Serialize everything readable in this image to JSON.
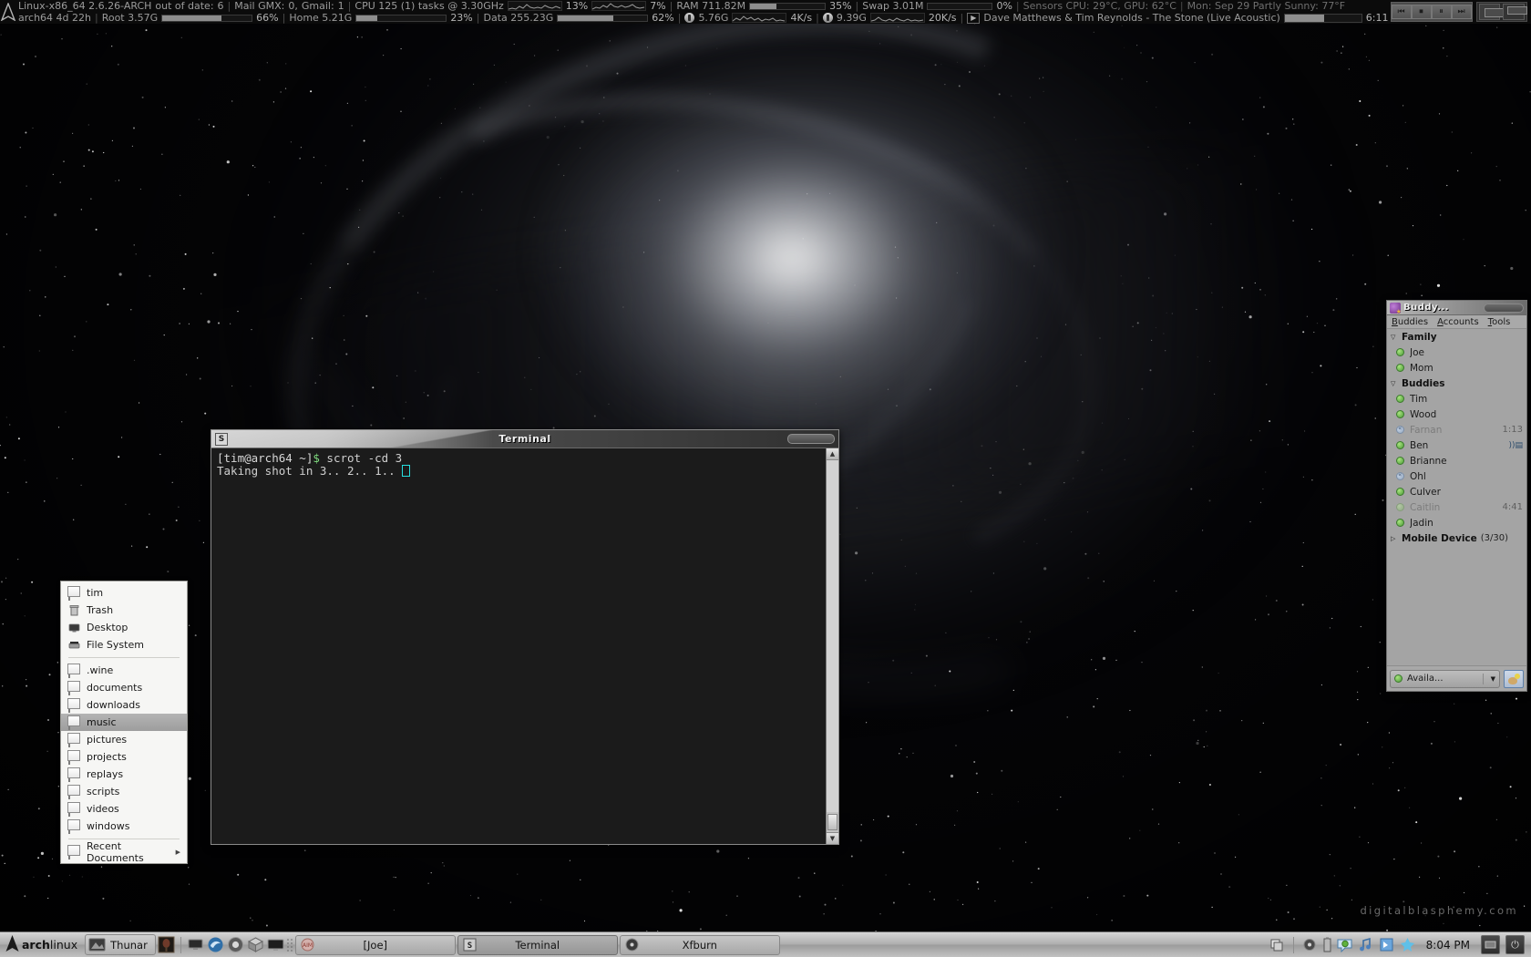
{
  "desktop": {
    "watermark": "digitalblasphemy.com"
  },
  "topbar": {
    "logo": "arch-logo",
    "row1": {
      "kernel": "Linux-x86_64 2.6.26-ARCH",
      "updates_label": "out of date:",
      "updates_count": "6",
      "mail_label": "Mail GMX:",
      "mail_gmx": "0,",
      "gmail_label": "Gmail:",
      "gmail_count": "1",
      "cpu_label": "CPU 125 (1) tasks @ 3.30GHz",
      "cpu1_pct": "13%",
      "cpu2_pct": "7%",
      "ram_label": "RAM 711.82M",
      "ram_pct": "35%",
      "swap_label": "Swap 3.01M",
      "swap_pct": "0%",
      "sensors": "Sensors CPU: 29°C, GPU: 62°C",
      "weather": "Mon: Sep 29 Partly Sunny: 77°F"
    },
    "row2": {
      "uptime": "arch64 4d 22h",
      "root_label": "Root 3.57G",
      "root_pct": "66%",
      "home_label": "Home 5.21G",
      "home_pct": "23%",
      "data_label": "Data 255.23G",
      "data_pct": "62%",
      "up_label": "5.76G",
      "up_rate": "4K/s",
      "down_label": "9.39G",
      "down_rate": "20K/s",
      "play_glyph": "▶",
      "now_playing": "Dave Matthews & Tim Reynolds - The Stone (Live Acoustic)",
      "track_time": "6:11"
    },
    "media_buttons": [
      {
        "name": "previous-track",
        "glyph": "⏮"
      },
      {
        "name": "stop",
        "glyph": "⏹"
      },
      {
        "name": "pause",
        "glyph": "⏸"
      },
      {
        "name": "next-track",
        "glyph": "⏭"
      }
    ]
  },
  "terminal": {
    "title": "Terminal",
    "icon": "terminal-icon",
    "lines": [
      {
        "prompt": "[tim@arch64 ~]$",
        "command": " scrot -cd 3"
      },
      {
        "text": "Taking shot in 3.. 2.. 1.."
      }
    ],
    "prompt_user": "[tim@arch64 ~]",
    "prompt_symbol": "$",
    "command": "scrot -cd 3",
    "output": "Taking shot in 3.. 2.. 1.."
  },
  "places_menu": {
    "groups": [
      {
        "items": [
          {
            "label": "tim",
            "icon": "home-folder-icon"
          },
          {
            "label": "Trash",
            "icon": "trash-icon"
          },
          {
            "label": "Desktop",
            "icon": "desktop-icon"
          },
          {
            "label": "File System",
            "icon": "drive-icon"
          }
        ]
      },
      {
        "items": [
          {
            "label": ".wine",
            "icon": "folder-icon"
          },
          {
            "label": "documents",
            "icon": "folder-icon"
          },
          {
            "label": "downloads",
            "icon": "folder-icon"
          },
          {
            "label": "music",
            "icon": "folder-icon",
            "selected": true
          },
          {
            "label": "pictures",
            "icon": "folder-icon"
          },
          {
            "label": "projects",
            "icon": "folder-icon"
          },
          {
            "label": "replays",
            "icon": "folder-icon"
          },
          {
            "label": "scripts",
            "icon": "folder-icon"
          },
          {
            "label": "videos",
            "icon": "folder-icon"
          },
          {
            "label": "windows",
            "icon": "folder-icon"
          }
        ]
      },
      {
        "items": [
          {
            "label": "Recent Documents",
            "icon": "recent-icon",
            "submenu": "▶"
          }
        ]
      }
    ]
  },
  "buddy_list": {
    "title": "Buddy...",
    "menus": [
      {
        "accel": "B",
        "rest": "uddies"
      },
      {
        "accel": "A",
        "rest": "ccounts"
      },
      {
        "accel": "T",
        "rest": "ools"
      }
    ],
    "groups": [
      {
        "name": "Family",
        "expanded": true,
        "arrow": "▽",
        "count": "",
        "buddies": [
          {
            "name": "Joe",
            "status": "available",
            "time": "",
            "mobile": false
          },
          {
            "name": "Mom",
            "status": "available",
            "time": "",
            "mobile": false
          }
        ]
      },
      {
        "name": "Buddies",
        "expanded": true,
        "arrow": "▽",
        "count": "",
        "buddies": [
          {
            "name": "Tim",
            "status": "available",
            "time": "",
            "mobile": false
          },
          {
            "name": "Wood",
            "status": "available",
            "time": "",
            "mobile": false
          },
          {
            "name": "Farnan",
            "status": "away",
            "time": "1:13",
            "mobile": false
          },
          {
            "name": "Ben",
            "status": "available",
            "time": "",
            "mobile": true
          },
          {
            "name": "Brianne",
            "status": "available",
            "time": "",
            "mobile": false
          },
          {
            "name": "Ohl",
            "status": "away",
            "time": "",
            "mobile": false
          },
          {
            "name": "Culver",
            "status": "available",
            "time": "",
            "mobile": false
          },
          {
            "name": "Caitlin",
            "status": "idle",
            "time": "4:41",
            "mobile": false
          },
          {
            "name": "Jadin",
            "status": "available",
            "time": "",
            "mobile": false
          }
        ]
      },
      {
        "name": "Mobile Device",
        "expanded": false,
        "arrow": "▷",
        "count": "(3/30)",
        "buddies": []
      }
    ],
    "status": {
      "label": "Availa...",
      "dropdown": "▼",
      "icon": "buddy-icon-button"
    }
  },
  "taskbar": {
    "start": {
      "brand_bold": "arch",
      "brand_light": "linux",
      "logo": "arch-logo-icon"
    },
    "thunar": {
      "label": "Thunar",
      "icon": "thunar-icon"
    },
    "launchers": [
      {
        "name": "wine-launcher",
        "icon": "wine-icon"
      },
      {
        "name": "terminal-launcher",
        "icon": "monitor-icon"
      },
      {
        "name": "browser-launcher",
        "icon": "firefox-icon"
      },
      {
        "name": "chromium-launcher",
        "icon": "chromium-icon"
      },
      {
        "name": "virtualbox-launcher",
        "icon": "cube-icon"
      },
      {
        "name": "display-launcher",
        "icon": "display-icon"
      }
    ],
    "windows": [
      {
        "label": "[Joe]",
        "icon": "aim-icon",
        "active": false
      },
      {
        "label": "Terminal",
        "icon": "terminal-icon",
        "active": true
      },
      {
        "label": "Xfburn",
        "icon": "cd-icon",
        "active": false
      }
    ],
    "tray": [
      {
        "name": "window-list-icon",
        "glyph": "🗗"
      },
      {
        "name": "volume-icon",
        "glyph": "🔊"
      },
      {
        "name": "battery-icon",
        "glyph": "▮"
      },
      {
        "name": "pidgin-tray-icon",
        "glyph": "💬"
      },
      {
        "name": "audacious-tray-icon",
        "glyph": "♪"
      },
      {
        "name": "clipboard-icon",
        "glyph": "📋"
      },
      {
        "name": "gimp-tray-icon",
        "glyph": "✴"
      }
    ],
    "clock": "8:04 PM",
    "sys_buttons": [
      {
        "name": "show-desktop-button",
        "glyph": "▭"
      },
      {
        "name": "power-button",
        "glyph": "⏻"
      }
    ]
  },
  "colors": {
    "accent": "#27e0e0",
    "status_online": "#5aa83f",
    "desktop_bg": "#050507",
    "panel_bg": "#b0b0b0",
    "conky_text": "#9c9c9c"
  }
}
